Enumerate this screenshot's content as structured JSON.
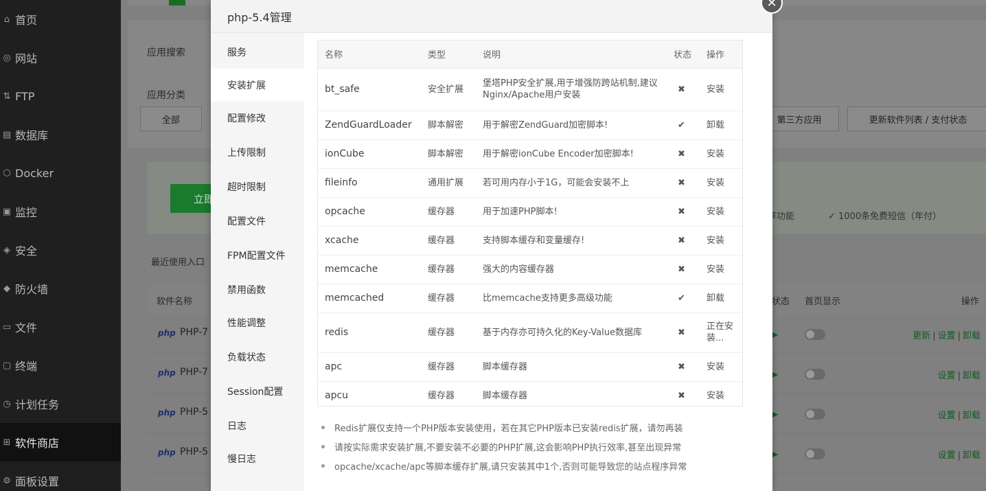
{
  "sidebar": {
    "items": [
      {
        "label": "首页",
        "icon": "home-icon",
        "glyph": "⌂"
      },
      {
        "label": "网站",
        "icon": "globe-icon",
        "glyph": "◎"
      },
      {
        "label": "FTP",
        "icon": "ftp-icon",
        "glyph": "⇅"
      },
      {
        "label": "数据库",
        "icon": "database-icon",
        "glyph": "▤"
      },
      {
        "label": "Docker",
        "icon": "docker-icon",
        "glyph": "⬡"
      },
      {
        "label": "监控",
        "icon": "monitor-icon",
        "glyph": "▣"
      },
      {
        "label": "安全",
        "icon": "shield-icon",
        "glyph": "◈"
      },
      {
        "label": "防火墙",
        "icon": "firewall-icon",
        "glyph": "◆"
      },
      {
        "label": "文件",
        "icon": "folder-icon",
        "glyph": "▭"
      },
      {
        "label": "终端",
        "icon": "terminal-icon",
        "glyph": "▢"
      },
      {
        "label": "计划任务",
        "icon": "clock-icon",
        "glyph": "◷"
      },
      {
        "label": "软件商店",
        "icon": "store-icon",
        "glyph": "⊞"
      },
      {
        "label": "面板设置",
        "icon": "settings-icon",
        "glyph": "⚙"
      }
    ]
  },
  "background": {
    "search_label": "应用搜索",
    "category_label": "应用分类",
    "all_button": "全部",
    "third_party_button": "第三方应用",
    "update_button": "更新软件列表 / 支付状态",
    "buy_button": "立即",
    "feature_text": "享功能",
    "sms_text": "✓ 1000条免费短信（年付）",
    "recent_label": "最近使用入口",
    "table_header": {
      "name": "软件名称",
      "status": "状态",
      "homepage": "首页显示",
      "ops": "操作"
    },
    "rows": [
      {
        "tag": "php",
        "name": "PHP-7",
        "ops": [
          "更新",
          "设置",
          "卸载"
        ]
      },
      {
        "tag": "php",
        "name": "PHP-7",
        "ops": [
          "设置",
          "卸载"
        ]
      },
      {
        "tag": "php",
        "name": "PHP-5",
        "ops": [
          "设置",
          "卸载"
        ]
      },
      {
        "tag": "php",
        "name": "PHP-5",
        "ops": [
          "设置",
          "卸载"
        ]
      }
    ]
  },
  "modal": {
    "title": "php-5.4管理",
    "close_glyph": "✕",
    "nav": [
      "服务",
      "安装扩展",
      "配置修改",
      "上传限制",
      "超时限制",
      "配置文件",
      "FPM配置文件",
      "禁用函数",
      "性能调整",
      "负载状态",
      "Session配置",
      "日志",
      "慢日志"
    ],
    "active_nav": "安装扩展",
    "table": {
      "headers": {
        "name": "名称",
        "type": "类型",
        "desc": "说明",
        "status": "状态",
        "op": "操作"
      },
      "rows": [
        {
          "name": "bt_safe",
          "type": "安全扩展",
          "desc": "堡塔PHP安全扩展,用于增强防跨站机制,建议Nginx/Apache用户安装",
          "status": "✖",
          "op": "安装",
          "op_color": "green"
        },
        {
          "name": "ZendGuardLoader",
          "type": "脚本解密",
          "desc": "用于解密ZendGuard加密脚本!",
          "status": "✔",
          "op": "卸载",
          "op_color": "red"
        },
        {
          "name": "ionCube",
          "type": "脚本解密",
          "desc": "用于解密ionCube Encoder加密脚本!",
          "status": "✖",
          "op": "安装",
          "op_color": "green"
        },
        {
          "name": "fileinfo",
          "type": "通用扩展",
          "desc": "若可用内存小于1G，可能会安装不上",
          "status": "✖",
          "op": "安装",
          "op_color": "green"
        },
        {
          "name": "opcache",
          "type": "缓存器",
          "desc": "用于加速PHP脚本!",
          "status": "✖",
          "op": "安装",
          "op_color": "green"
        },
        {
          "name": "xcache",
          "type": "缓存器",
          "desc": "支持脚本缓存和变量缓存!",
          "status": "✖",
          "op": "安装",
          "op_color": "green"
        },
        {
          "name": "memcache",
          "type": "缓存器",
          "desc": "强大的内容缓存器",
          "status": "✖",
          "op": "安装",
          "op_color": "green"
        },
        {
          "name": "memcached",
          "type": "缓存器",
          "desc": "比memcache支持更多高级功能",
          "status": "✔",
          "op": "卸载",
          "op_color": "red"
        },
        {
          "name": "redis",
          "type": "缓存器",
          "desc": "基于内存亦可持久化的Key-Value数据库",
          "status": "✖",
          "op": "正在安装...",
          "op_color": "green"
        },
        {
          "name": "apc",
          "type": "缓存器",
          "desc": "脚本缓存器",
          "status": "✖",
          "op": "安装",
          "op_color": "green"
        },
        {
          "name": "apcu",
          "type": "缓存器",
          "desc": "脚本缓存器",
          "status": "✖",
          "op": "安装",
          "op_color": "green"
        }
      ]
    },
    "tips": [
      "Redis扩展仅支持一个PHP版本安装使用，若在其它PHP版本已安装redis扩展，请勿再装",
      "请按实际需求安装扩展,不要安装不必要的PHP扩展,这会影响PHP执行效率,甚至出现异常",
      "opcache/xcache/apc等脚本缓存扩展,请只安装其中1个,否则可能导致您的站点程序异常"
    ]
  },
  "colors": {
    "accent_green": "#20a53a",
    "danger_red": "#e53935"
  }
}
